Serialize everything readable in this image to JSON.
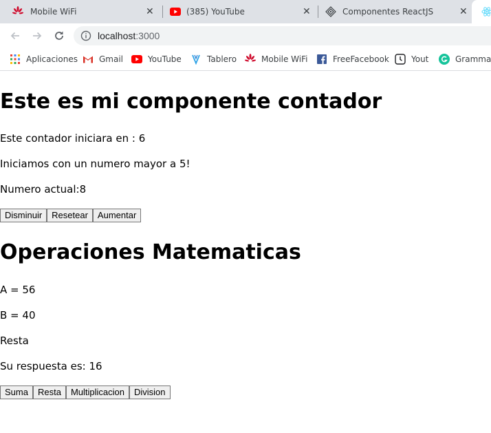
{
  "tabs": [
    {
      "title": "Mobile WiFi",
      "icon": "huawei-icon"
    },
    {
      "title": "(385) YouTube",
      "icon": "youtube-icon"
    },
    {
      "title": "Componentes ReactJS",
      "icon": "react-icon"
    }
  ],
  "address_bar": {
    "host": "localhost",
    "port": ":3000"
  },
  "bookmarks": [
    {
      "label": "Aplicaciones",
      "icon": "apps-grid-icon"
    },
    {
      "label": "Gmail",
      "icon": "gmail-icon"
    },
    {
      "label": "YouTube",
      "icon": "youtube-icon"
    },
    {
      "label": "Tablero",
      "icon": "tablero-icon"
    },
    {
      "label": "Mobile WiFi",
      "icon": "huawei-icon"
    },
    {
      "label": "FreeFacebook",
      "icon": "facebook-icon"
    },
    {
      "label": "Yout",
      "icon": "clock-icon"
    },
    {
      "label": "Grammarl",
      "icon": "grammarly-icon"
    }
  ],
  "counter": {
    "heading": "Este es mi componente contador",
    "initial_text": "Este contador iniciara en : 6",
    "message": "Iniciamos con un numero mayor a 5!",
    "current": "Numero actual:8",
    "buttons": {
      "decrease": "Disminuir",
      "reset": "Resetear",
      "increase": "Aumentar"
    }
  },
  "math": {
    "heading": "Operaciones Matematicas",
    "a_text": "A = 56",
    "b_text": "B = 40",
    "operation": "Resta",
    "answer": "Su respuesta es: 16",
    "buttons": {
      "sum": "Suma",
      "subtract": "Resta",
      "multiply": "Multiplicacion",
      "divide": "Division"
    }
  },
  "colors": {
    "tabstrip_bg": "#dee1e6",
    "omnibox_bg": "#f1f3f4",
    "youtube_red": "#ff0000",
    "huawei_red": "#cf0a2c",
    "facebook_blue": "#3b5998",
    "grammarly_green": "#15c39a"
  }
}
